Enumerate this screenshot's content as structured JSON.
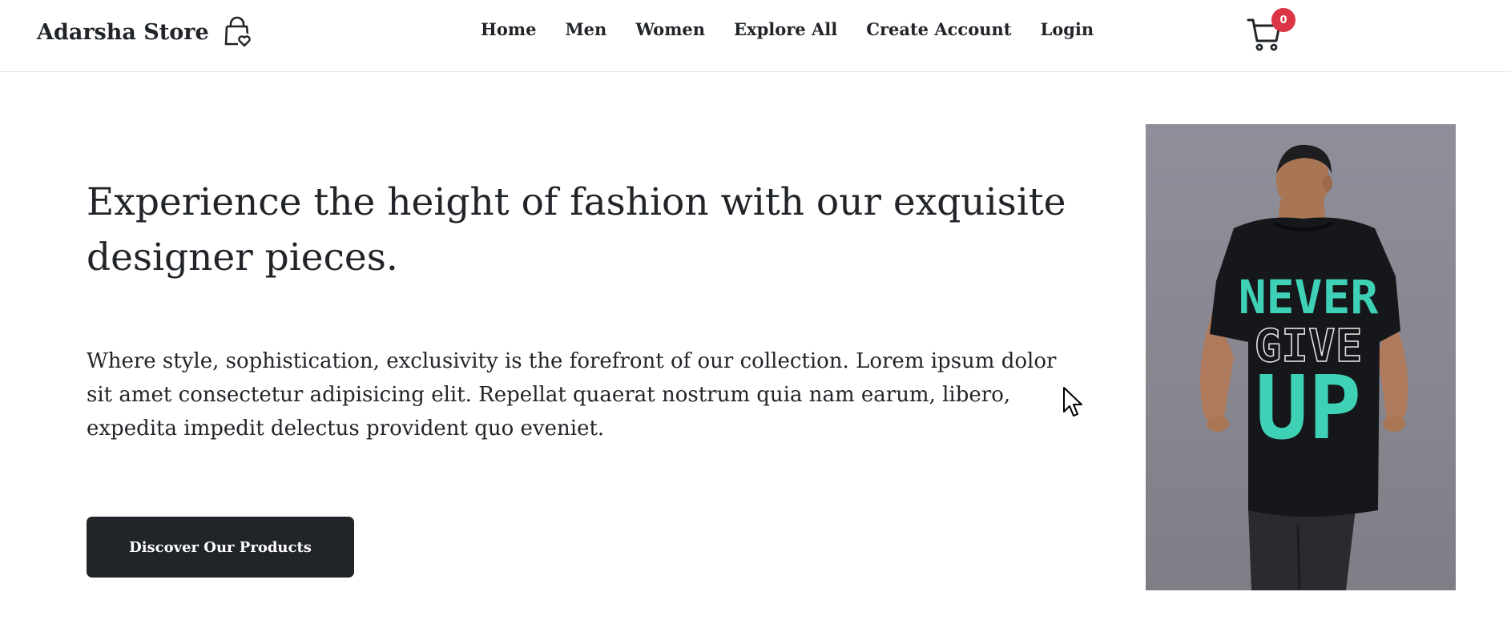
{
  "brand": {
    "name": "Adarsha Store",
    "icon": "shopping-bag-heart-icon"
  },
  "nav": {
    "links": [
      {
        "label": "Home"
      },
      {
        "label": "Men"
      },
      {
        "label": "Women"
      },
      {
        "label": "Explore All"
      },
      {
        "label": "Create Account"
      },
      {
        "label": "Login"
      }
    ]
  },
  "cart": {
    "icon": "cart-icon",
    "count": "0",
    "badge_color": "#dc3545"
  },
  "hero": {
    "heading": "Experience the height of fashion with our exquisite designer pieces.",
    "text": "Where style, sophistication, exclusivity is the forefront of our collection. Lorem ipsum dolor sit amet consectetur adipisicing elit. Repellat quaerat nostrum quia nam earum, libero, expedita impedit delectus provident quo eveniet.",
    "button_label": "Discover Our Products",
    "button_color": "#212529",
    "image": {
      "description_icon": "tshirt-model-photo",
      "shirt_text_line1": "NEVER",
      "shirt_text_line2": "GIVE",
      "shirt_text_line3": "UP",
      "print_color": "#3fd1b6"
    }
  }
}
